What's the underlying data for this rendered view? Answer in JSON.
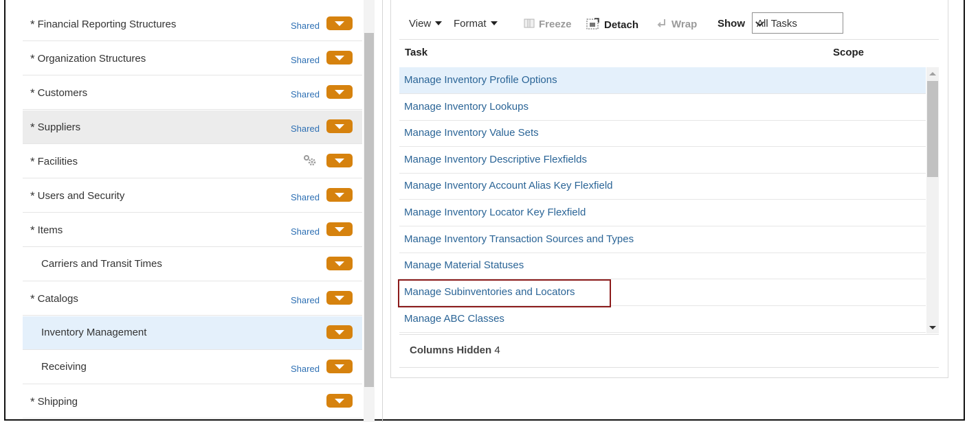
{
  "functional_areas": [
    {
      "name": "Financial Reporting Structures",
      "required": true,
      "status": "Shared"
    },
    {
      "name": "Organization Structures",
      "required": true,
      "status": "Shared"
    },
    {
      "name": "Customers",
      "required": true,
      "status": "Shared"
    },
    {
      "name": "Suppliers",
      "required": true,
      "status": "Shared"
    },
    {
      "name": "Facilities",
      "required": true,
      "status": ""
    },
    {
      "name": "Users and Security",
      "required": true,
      "status": "Shared"
    },
    {
      "name": "Items",
      "required": true,
      "status": "Shared"
    },
    {
      "name": "Carriers and Transit Times",
      "required": false,
      "status": ""
    },
    {
      "name": "Catalogs",
      "required": true,
      "status": "Shared"
    },
    {
      "name": "Inventory Management",
      "required": false,
      "status": ""
    },
    {
      "name": "Receiving",
      "required": false,
      "status": "Shared"
    },
    {
      "name": "Shipping",
      "required": true,
      "status": ""
    }
  ],
  "required_marker": "*",
  "toolbar": {
    "view": "View",
    "format": "Format",
    "freeze": "Freeze",
    "detach": "Detach",
    "wrap": "Wrap",
    "show_label": "Show",
    "show_value": "All Tasks"
  },
  "table": {
    "columns": [
      "Task",
      "Scope"
    ],
    "rows": [
      "Manage Inventory Profile Options",
      "Manage Inventory Lookups",
      "Manage Inventory Value Sets",
      "Manage Inventory Descriptive Flexfields",
      "Manage Inventory Account Alias Key Flexfield",
      "Manage Inventory Locator Key Flexfield",
      "Manage Inventory Transaction Sources and Types",
      "Manage Material Statuses",
      "Manage Subinventories and Locators",
      "Manage ABC Classes"
    ],
    "selected_row": "Manage Inventory Profile Options",
    "highlighted_task": "Manage Subinventories and Locators"
  },
  "footer": {
    "columns_hidden_label": "Columns Hidden",
    "columns_hidden_count": "4"
  },
  "colors": {
    "accent_orange": "#d6820e",
    "link_blue": "#2a6496",
    "selection_blue": "#e4f0fb",
    "callout_red": "#8b1a1a"
  }
}
